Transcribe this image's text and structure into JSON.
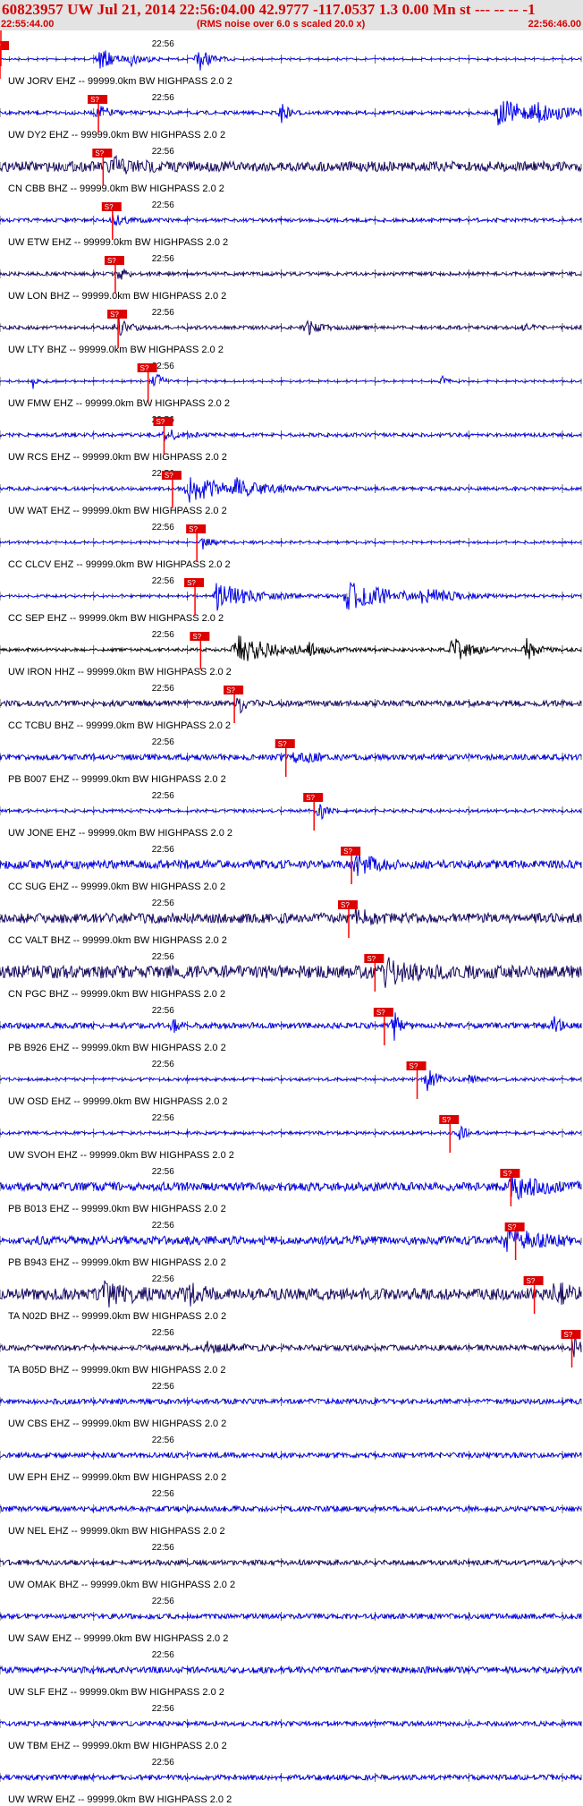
{
  "header": {
    "title": "60823957 UW Jul 21, 2014 22:56:04.00   42.9777 -117.0537  1.3 0.00 Mn st --- -- --  -1",
    "start_time": "22:55:44.00",
    "noise_note": "(RMS noise over 6.0 s scaled 20.0 x)",
    "end_time": "22:56:46.00"
  },
  "colors": {
    "header_text": "#d40000",
    "header_bg": "#e3e3e3",
    "pick_marker": "#ff0000",
    "pick_box": "#dd0000",
    "trace_blue": "#0000ee",
    "trace_indigo": "#1a0a66",
    "trace_black": "#000000",
    "tick": "#000000"
  },
  "chart_data": {
    "type": "seismogram",
    "x_unit": "seconds after 22:55:44.00",
    "xlim": [
      0,
      62
    ],
    "minute_mark_label": "22:56",
    "minute_mark_time": 16,
    "pick_label": "S?",
    "traces": [
      {
        "label": "UW JORV EHZ -- 99999.0km BW  HIGHPASS  2.0  2",
        "color": "trace_blue",
        "pick": 0,
        "noise": 0.06,
        "bursts": [
          [
            10.5,
            1.5,
            0.9
          ],
          [
            21.0,
            1.2,
            1.0
          ],
          [
            14.0,
            1.5,
            0.4
          ]
        ]
      },
      {
        "label": "UW DY2 EHZ -- 99999.0km BW  HIGHPASS  2.0  2",
        "color": "trace_blue",
        "pick": 10.5,
        "noise": 0.12,
        "bursts": [
          [
            10.5,
            1.0,
            0.6
          ],
          [
            53.0,
            3.5,
            1.0
          ],
          [
            57.0,
            2.5,
            0.6
          ],
          [
            30.0,
            0.6,
            0.9
          ]
        ]
      },
      {
        "label": "CN CBB BHZ -- 99999.0km BW  HIGHPASS  2.0  2",
        "color": "trace_indigo",
        "pick": 11.0,
        "noise": 0.35,
        "bursts": [
          [
            11.5,
            2.5,
            0.6
          ]
        ]
      },
      {
        "label": "UW ETW EHZ -- 99999.0km BW  HIGHPASS  2.0  2",
        "color": "trace_blue",
        "pick": 12.0,
        "noise": 0.12,
        "bursts": [
          [
            12.0,
            1.5,
            0.4
          ]
        ]
      },
      {
        "label": "UW LON BHZ -- 99999.0km BW  HIGHPASS  2.0  2",
        "color": "trace_indigo",
        "pick": 12.3,
        "noise": 0.12,
        "bursts": [
          [
            12.5,
            1.0,
            0.5
          ]
        ]
      },
      {
        "label": "UW LTY BHZ -- 99999.0km BW  HIGHPASS  2.0  2",
        "color": "trace_indigo",
        "pick": 12.6,
        "noise": 0.12,
        "bursts": [
          [
            12.5,
            1.0,
            0.8
          ],
          [
            32.5,
            1.5,
            0.6
          ],
          [
            56.0,
            0.5,
            0.5
          ]
        ]
      },
      {
        "label": "UW FMW EHZ -- 99999.0km BW  HIGHPASS  2.0  2",
        "color": "trace_blue",
        "pick": 15.8,
        "noise": 0.06,
        "bursts": [
          [
            16.5,
            0.6,
            1.0
          ],
          [
            3.5,
            0.6,
            0.5
          ],
          [
            47.0,
            0.6,
            0.5
          ]
        ]
      },
      {
        "label": "UW RCS EHZ -- 99999.0km BW  HIGHPASS  2.0  2",
        "color": "trace_blue",
        "pick": 17.5,
        "noise": 0.12,
        "bursts": [
          [
            17.5,
            1.5,
            0.5
          ]
        ]
      },
      {
        "label": "UW WAT EHZ -- 99999.0km BW  HIGHPASS  2.0  2",
        "color": "trace_blue",
        "pick": 18.4,
        "noise": 0.12,
        "bursts": [
          [
            20.0,
            3.5,
            1.0
          ],
          [
            25.0,
            3.0,
            0.5
          ]
        ]
      },
      {
        "label": "CC CLCV EHZ -- 99999.0km BW  HIGHPASS  2.0  2",
        "color": "trace_blue",
        "pick": 21.0,
        "noise": 0.08,
        "bursts": [
          [
            21.5,
            1.0,
            0.5
          ]
        ]
      },
      {
        "label": "CC SEP EHZ -- 99999.0km BW  HIGHPASS  2.0  2",
        "color": "trace_blue",
        "pick": 20.8,
        "noise": 0.08,
        "bursts": [
          [
            23.0,
            3.5,
            1.0
          ],
          [
            37.0,
            5.0,
            1.0
          ],
          [
            45.0,
            3.0,
            0.4
          ]
        ]
      },
      {
        "label": "UW IRON HHZ -- 99999.0km BW  HIGHPASS  2.0  2",
        "color": "trace_black",
        "pick": 21.4,
        "noise": 0.1,
        "bursts": [
          [
            25.0,
            4.0,
            1.0
          ],
          [
            48.0,
            2.0,
            1.0
          ],
          [
            56.0,
            1.0,
            1.0
          ],
          [
            33.0,
            1.0,
            0.5
          ]
        ]
      },
      {
        "label": "CC TCBU BHZ -- 99999.0km BW  HIGHPASS  2.0  2",
        "color": "trace_indigo",
        "pick": 25.0,
        "noise": 0.2,
        "bursts": [
          [
            25.5,
            0.7,
            0.7
          ]
        ]
      },
      {
        "label": "PB B007 EHZ -- 99999.0km BW  HIGHPASS  2.0  2",
        "color": "trace_blue",
        "pick": 30.5,
        "noise": 0.2,
        "bursts": [
          [
            31.5,
            1.5,
            0.5
          ]
        ]
      },
      {
        "label": "UW JONE EHZ -- 99999.0km BW  HIGHPASS  2.0  2",
        "color": "trace_blue",
        "pick": 33.5,
        "noise": 0.1,
        "bursts": [
          [
            33.8,
            0.8,
            1.0
          ]
        ]
      },
      {
        "label": "CC SUG EHZ -- 99999.0km BW  HIGHPASS  2.0  2",
        "color": "trace_blue",
        "pick": 37.5,
        "noise": 0.3,
        "bursts": [
          [
            38.0,
            1.5,
            0.8
          ]
        ]
      },
      {
        "label": "CC VALT BHZ -- 99999.0km BW  HIGHPASS  2.0  2",
        "color": "trace_indigo",
        "pick": 37.2,
        "noise": 0.35,
        "bursts": [
          [
            37.8,
            1.0,
            0.9
          ]
        ]
      },
      {
        "label": "CN PGC BHZ -- 99999.0km BW  HIGHPASS  2.0  2",
        "color": "trace_indigo",
        "pick": 40.0,
        "noise": 0.45,
        "bursts": [
          [
            41.0,
            3.0,
            0.7
          ]
        ]
      },
      {
        "label": "PB B926 EHZ -- 99999.0km BW  HIGHPASS  2.0  2",
        "color": "trace_blue",
        "pick": 41.0,
        "noise": 0.2,
        "bursts": [
          [
            42.0,
            0.6,
            1.0
          ],
          [
            59.0,
            0.6,
            0.7
          ],
          [
            18.5,
            0.5,
            0.4
          ]
        ]
      },
      {
        "label": "UW OSD EHZ -- 99999.0km BW  HIGHPASS  2.0  2",
        "color": "trace_blue",
        "pick": 44.5,
        "noise": 0.1,
        "bursts": [
          [
            45.5,
            1.2,
            0.8
          ],
          [
            50.0,
            0.8,
            0.3
          ]
        ]
      },
      {
        "label": "UW SVOH EHZ -- 99999.0km BW  HIGHPASS  2.0  2",
        "color": "trace_blue",
        "pick": 48.0,
        "noise": 0.1,
        "bursts": [
          [
            49.0,
            0.8,
            0.5
          ]
        ]
      },
      {
        "label": "PB B013 EHZ -- 99999.0km BW  HIGHPASS  2.0  2",
        "color": "trace_blue",
        "pick": 54.5,
        "noise": 0.3,
        "bursts": [
          [
            54.5,
            3.0,
            0.8
          ]
        ]
      },
      {
        "label": "PB B943 EHZ -- 99999.0km BW  HIGHPASS  2.0  2",
        "color": "trace_blue",
        "pick": 55.0,
        "noise": 0.3,
        "bursts": [
          [
            54.0,
            3.0,
            0.8
          ]
        ]
      },
      {
        "label": "TA N02D BHZ -- 99999.0km BW  HIGHPASS  2.0  2",
        "color": "trace_indigo",
        "pick": 57.0,
        "noise": 0.4,
        "bursts": [
          [
            11.0,
            2.5,
            0.8
          ],
          [
            20.0,
            1.5,
            0.6
          ],
          [
            59.0,
            1.5,
            0.8
          ]
        ]
      },
      {
        "label": "TA B05D BHZ -- 99999.0km BW  HIGHPASS  2.0  2",
        "color": "trace_indigo",
        "pick": 61.0,
        "noise": 0.2,
        "bursts": [
          [
            61.2,
            0.5,
            1.0
          ],
          [
            22.0,
            3.0,
            0.3
          ]
        ]
      },
      {
        "label": "UW CBS EHZ -- 99999.0km BW  HIGHPASS  2.0  2",
        "color": "trace_blue",
        "pick": null,
        "noise": 0.18,
        "bursts": []
      },
      {
        "label": "UW EPH EHZ -- 99999.0km BW  HIGHPASS  2.0  2",
        "color": "trace_blue",
        "pick": null,
        "noise": 0.18,
        "bursts": []
      },
      {
        "label": "UW NEL EHZ -- 99999.0km BW  HIGHPASS  2.0  2",
        "color": "trace_blue",
        "pick": null,
        "noise": 0.18,
        "bursts": []
      },
      {
        "label": "UW OMAK BHZ -- 99999.0km BW  HIGHPASS  2.0  2",
        "color": "trace_indigo",
        "pick": null,
        "noise": 0.18,
        "bursts": []
      },
      {
        "label": "UW SAW EHZ -- 99999.0km BW  HIGHPASS  2.0  2",
        "color": "trace_blue",
        "pick": null,
        "noise": 0.18,
        "bursts": []
      },
      {
        "label": "UW SLF EHZ -- 99999.0km BW  HIGHPASS  2.0  2",
        "color": "trace_blue",
        "pick": null,
        "noise": 0.22,
        "bursts": []
      },
      {
        "label": "UW TBM EHZ -- 99999.0km BW  HIGHPASS  2.0  2",
        "color": "trace_blue",
        "pick": null,
        "noise": 0.16,
        "bursts": []
      },
      {
        "label": "UW WRW EHZ -- 99999.0km BW  HIGHPASS  2.0  2",
        "color": "trace_blue",
        "pick": null,
        "noise": 0.18,
        "bursts": []
      }
    ]
  }
}
